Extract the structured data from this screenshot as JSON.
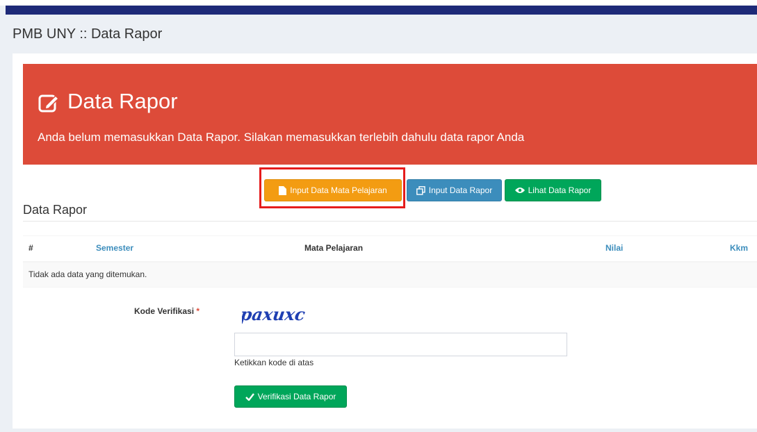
{
  "page": {
    "title": "PMB UNY :: Data Rapor"
  },
  "alert": {
    "title": "Data Rapor",
    "text": "Anda belum memasukkan Data Rapor. Silakan memasukkan terlebih dahulu data rapor Anda"
  },
  "buttons": {
    "input_mapel": "Input Data Mata Pelajaran",
    "input_rapor": "Input Data Rapor",
    "lihat_rapor": "Lihat Data Rapor"
  },
  "section": {
    "title": "Data Rapor"
  },
  "table": {
    "columns": [
      "#",
      "Semester",
      "Mata Pelajaran",
      "Nilai",
      "Kkm"
    ],
    "empty_text": "Tidak ada data yang ditemukan."
  },
  "form": {
    "label": "Kode Verifikasi",
    "required_mark": "*",
    "captcha_text": "paxuxc",
    "input_value": "",
    "hint": "Ketikkan kode di atas",
    "submit_label": "Verifikasi Data Rapor"
  },
  "colors": {
    "alert": "#dd4b39",
    "warning": "#f39c12",
    "primary": "#3c8dbc",
    "success": "#00a65a",
    "highlight": "#e51c1c",
    "captcha": "#1f3fb2"
  },
  "icons": {
    "alert": "edit-icon",
    "input_mapel": "file-icon",
    "input_rapor": "copy-icon",
    "lihat_rapor": "eye-icon",
    "submit": "check-icon"
  }
}
